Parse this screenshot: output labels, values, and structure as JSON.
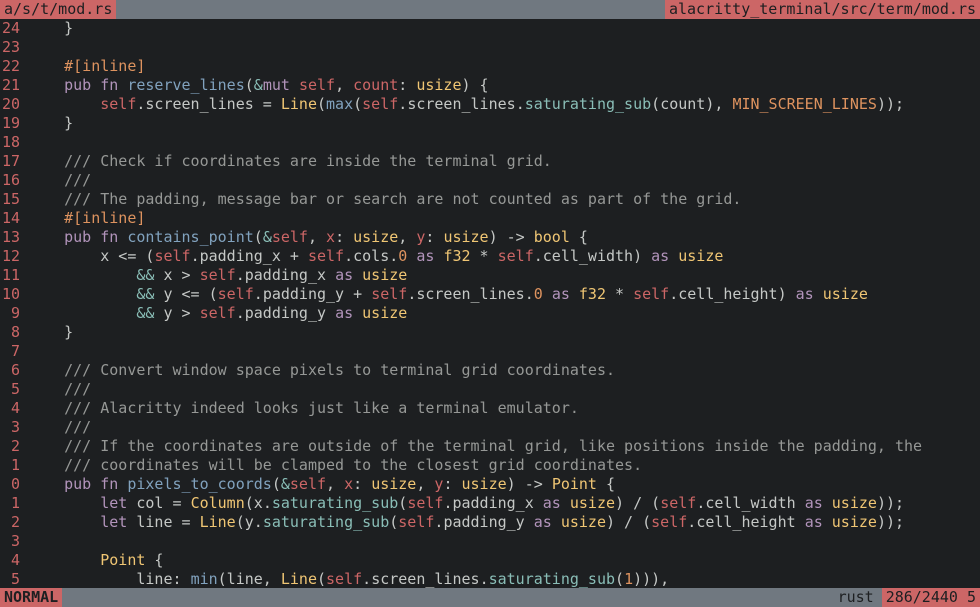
{
  "header": {
    "tab": "a/s/t/mod.rs",
    "full_path": "alacritty_terminal/src/term/mod.rs"
  },
  "gutter": [
    "24",
    "23",
    "22",
    "21",
    "20",
    "19",
    "18",
    "17",
    "16",
    "15",
    "14",
    "13",
    "12",
    "11",
    "10",
    "9",
    "8",
    "7",
    "6",
    "5",
    "4",
    "3",
    "2",
    "1",
    "0",
    "1",
    "2",
    "3",
    "4",
    "5"
  ],
  "code": {
    "l0": "}",
    "l2_attr": "#[inline]",
    "l3_pub": "pub ",
    "l3_fn": "fn ",
    "l3_name": "reserve_lines",
    "l3_sig1": "(",
    "l3_amp": "&",
    "l3_mut": "mut ",
    "l3_self": "self",
    "l3_c1": ", ",
    "l3_p1": "count",
    "l3_c2": ": ",
    "l3_t1": "usize",
    "l3_sig2": ") {",
    "l4_a": "self",
    "l4_b": ".",
    "l4_c": "screen_lines",
    "l4_d": " = ",
    "l4_e": "Line",
    "l4_f": "(",
    "l4_g": "max",
    "l4_h": "(",
    "l4_i": "self",
    "l4_j": ".",
    "l4_k": "screen_lines",
    "l4_l": ".",
    "l4_m": "saturating_sub",
    "l4_n": "(",
    "l4_o": "count",
    "l4_p": "), ",
    "l4_q": "MIN_SCREEN_LINES",
    "l4_r": "));",
    "l5": "}",
    "l7": "/// Check if coordinates are inside the terminal grid.",
    "l8": "///",
    "l9": "/// The padding, message bar or search are not counted as part of the grid.",
    "l10_attr": "#[inline]",
    "l11_pub": "pub ",
    "l11_fn": "fn ",
    "l11_name": "contains_point",
    "l11_s1": "(",
    "l11_amp": "&",
    "l11_self": "self",
    "l11_c1": ", ",
    "l11_px": "x",
    "l11_c2": ": ",
    "l11_t1": "usize",
    "l11_c3": ", ",
    "l11_py": "y",
    "l11_c4": ": ",
    "l11_t2": "usize",
    "l11_s2": ") -> ",
    "l11_ret": "bool",
    "l11_s3": " {",
    "l12_a": "x",
    "l12_b": " <= (",
    "l12_c": "self",
    "l12_d": ".",
    "l12_e": "padding_x",
    "l12_f": " + ",
    "l12_g": "self",
    "l12_h": ".",
    "l12_i": "cols",
    "l12_j": ".",
    "l12_k": "0",
    "l12_l": " ",
    "l12_m": "as",
    "l12_n": " ",
    "l12_o": "f32",
    "l12_p": " * ",
    "l12_q": "self",
    "l12_r": ".",
    "l12_s": "cell_width",
    "l12_t": ") ",
    "l12_u": "as",
    "l12_v": " ",
    "l12_w": "usize",
    "l13_a": "&& ",
    "l13_b": "x",
    "l13_c": " > ",
    "l13_d": "self",
    "l13_e": ".",
    "l13_f": "padding_x",
    "l13_g": " ",
    "l13_h": "as",
    "l13_i": " ",
    "l13_j": "usize",
    "l14_a": "&& ",
    "l14_b": "y",
    "l14_c": " <= (",
    "l14_d": "self",
    "l14_e": ".",
    "l14_f": "padding_y",
    "l14_g": " + ",
    "l14_h": "self",
    "l14_i": ".",
    "l14_j": "screen_lines",
    "l14_k": ".",
    "l14_l": "0",
    "l14_m": " ",
    "l14_n": "as",
    "l14_o": " ",
    "l14_p": "f32",
    "l14_q": " * ",
    "l14_r": "self",
    "l14_s": ".",
    "l14_t": "cell_height",
    "l14_u": ") ",
    "l14_v": "as",
    "l14_w": " ",
    "l14_x": "usize",
    "l15_a": "&& ",
    "l15_b": "y",
    "l15_c": " > ",
    "l15_d": "self",
    "l15_e": ".",
    "l15_f": "padding_y",
    "l15_g": " ",
    "l15_h": "as",
    "l15_i": " ",
    "l15_j": "usize",
    "l16": "}",
    "l18": "/// Convert window space pixels to terminal grid coordinates.",
    "l19": "///",
    "l20": "/// Alacritty indeed looks just like a terminal emulator.",
    "l21": "///",
    "l22": "/// If the coordinates are outside of the terminal grid, like positions inside the padding, the",
    "l23": "/// coordinates will be clamped to the closest grid coordinates.",
    "l24_pub": "pub ",
    "l24_fn": "fn ",
    "l24_name": "pixels_to_coords",
    "l24_s1": "(",
    "l24_amp": "&",
    "l24_self": "self",
    "l24_c1": ", ",
    "l24_px": "x",
    "l24_c2": ": ",
    "l24_t1": "usize",
    "l24_c3": ", ",
    "l24_py": "y",
    "l24_c4": ": ",
    "l24_t2": "usize",
    "l24_s2": ") -> ",
    "l24_ret": "Point",
    "l24_s3": " {",
    "l25_a": "let",
    "l25_b": " col = ",
    "l25_c": "Column",
    "l25_d": "(",
    "l25_e": "x",
    "l25_f": ".",
    "l25_g": "saturating_sub",
    "l25_h": "(",
    "l25_i": "self",
    "l25_j": ".",
    "l25_k": "padding_x",
    "l25_l": " ",
    "l25_m": "as",
    "l25_n": " ",
    "l25_o": "usize",
    "l25_p": ") / (",
    "l25_q": "self",
    "l25_r": ".",
    "l25_s": "cell_width",
    "l25_t": " ",
    "l25_u": "as",
    "l25_v": " ",
    "l25_w": "usize",
    "l25_x": "));",
    "l26_a": "let",
    "l26_b": " line = ",
    "l26_c": "Line",
    "l26_d": "(",
    "l26_e": "y",
    "l26_f": ".",
    "l26_g": "saturating_sub",
    "l26_h": "(",
    "l26_i": "self",
    "l26_j": ".",
    "l26_k": "padding_y",
    "l26_l": " ",
    "l26_m": "as",
    "l26_n": " ",
    "l26_o": "usize",
    "l26_p": ") / (",
    "l26_q": "self",
    "l26_r": ".",
    "l26_s": "cell_height",
    "l26_t": " ",
    "l26_u": "as",
    "l26_v": " ",
    "l26_w": "usize",
    "l26_x": "));",
    "l28_a": "Point",
    "l28_b": " {",
    "l29_a": "line: ",
    "l29_b": "min",
    "l29_c": "(line, ",
    "l29_d": "Line",
    "l29_e": "(",
    "l29_f": "self",
    "l29_g": ".",
    "l29_h": "screen_lines",
    "l29_i": ".",
    "l29_j": "saturating_sub",
    "l29_k": "(",
    "l29_l": "1",
    "l29_m": "))),"
  },
  "footer": {
    "mode": "NORMAL",
    "lang": "rust",
    "position": "286/2440 5"
  }
}
